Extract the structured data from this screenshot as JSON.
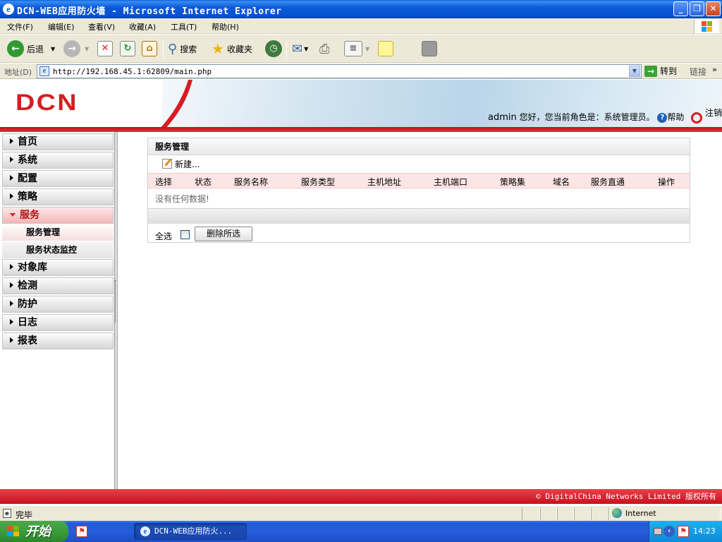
{
  "window": {
    "title": "DCN-WEB应用防火墙 - Microsoft Internet Explorer",
    "buttons": {
      "minimize": "_",
      "maximize": "❐",
      "close": "✕"
    }
  },
  "menu": [
    "文件(F)",
    "编辑(E)",
    "查看(V)",
    "收藏(A)",
    "工具(T)",
    "帮助(H)"
  ],
  "toolbar": {
    "back": "后退",
    "search": "搜索",
    "favorites": "收藏夹"
  },
  "address": {
    "label": "地址(D)",
    "url": "http://192.168.45.1:62809/main.php",
    "go": "转到",
    "links": "链接",
    "more": "»"
  },
  "header": {
    "logo": "DCN",
    "user": "admin",
    "greeting": "您好，您当前角色是：系统管理员。",
    "help": "帮助",
    "logout": "注销",
    "brand_color": "#d41e23"
  },
  "sidebar": {
    "items": [
      {
        "label": "首页"
      },
      {
        "label": "系统"
      },
      {
        "label": "配置"
      },
      {
        "label": "策略"
      },
      {
        "label": "服务",
        "expanded": true,
        "children": [
          {
            "label": "服务管理",
            "selected": true
          },
          {
            "label": "服务状态监控"
          }
        ]
      },
      {
        "label": "对象库"
      },
      {
        "label": "检测"
      },
      {
        "label": "防护"
      },
      {
        "label": "日志"
      },
      {
        "label": "报表"
      }
    ]
  },
  "panel": {
    "title": "服务管理",
    "new_label": "新建...",
    "columns": [
      "选择",
      "状态",
      "服务名称",
      "服务类型",
      "主机地址",
      "主机端口",
      "策略集",
      "域名",
      "服务直通",
      "操作"
    ],
    "empty_message": "没有任何数据!",
    "select_all": "全选",
    "delete_selected": "删除所选"
  },
  "footer": {
    "copyright": "© DigitalChina Networks Limited 版权所有"
  },
  "statusbar": {
    "status": "完毕",
    "zone": "Internet"
  },
  "taskbar": {
    "start": "开始",
    "task": "DCN-WEB应用防火...",
    "clock": "14:23"
  }
}
